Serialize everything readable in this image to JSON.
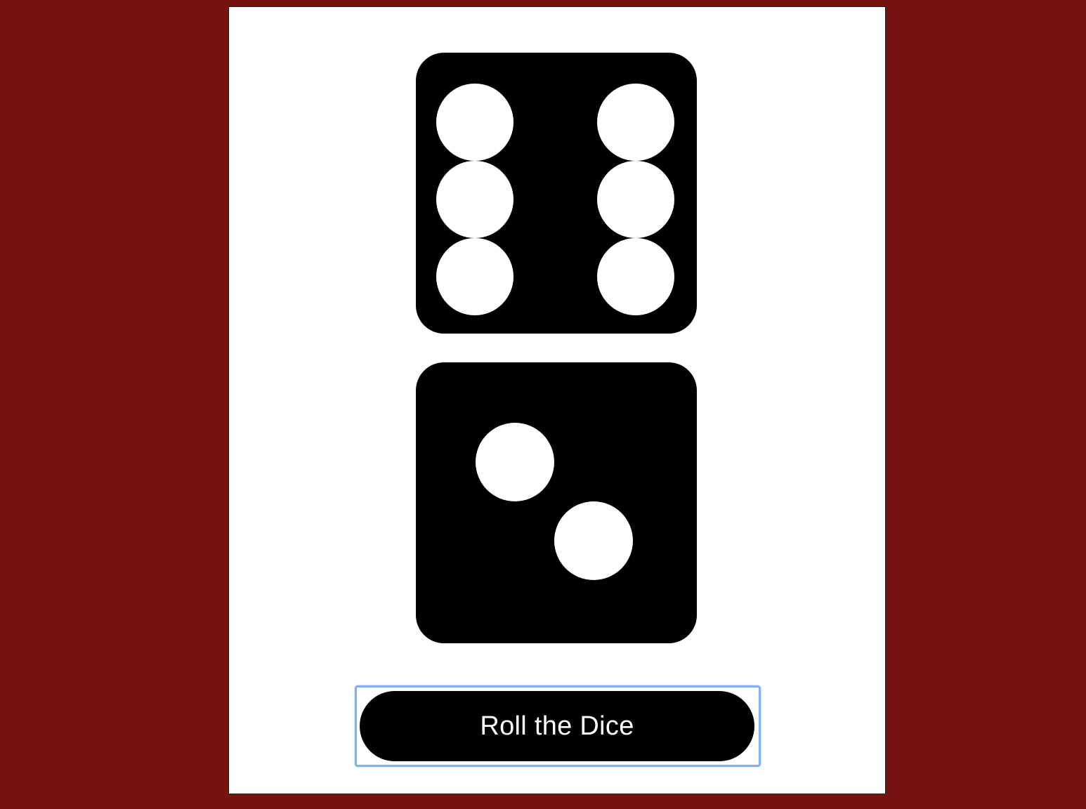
{
  "colors": {
    "backdrop": "#74130f",
    "panel": "#ffffff",
    "die_face": "#000000",
    "pip": "#ffffff",
    "button_bg": "#000000",
    "button_text": "#ffffff",
    "focus_ring": "#86aef5"
  },
  "dice": [
    {
      "value": 6
    },
    {
      "value": 2
    }
  ],
  "roll_button": {
    "label": "Roll the Dice"
  }
}
